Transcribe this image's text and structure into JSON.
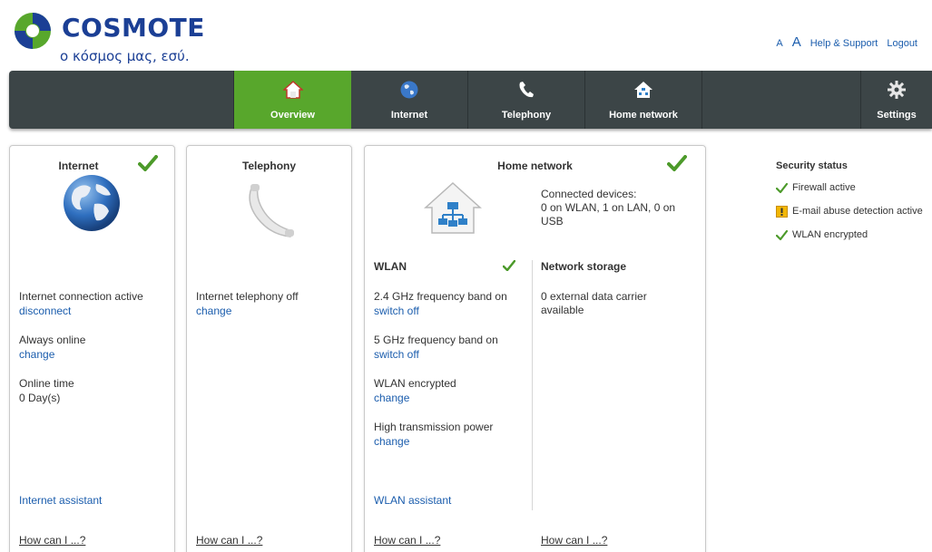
{
  "brand": {
    "name": "COSMOTE",
    "tagline": "ο κόσμος μας, εσύ."
  },
  "top_links": {
    "font_small": "A",
    "font_large": "A",
    "help": "Help & Support",
    "logout": "Logout"
  },
  "nav": {
    "tabs": [
      {
        "label": "Overview",
        "icon": "home-icon",
        "active": true
      },
      {
        "label": "Internet",
        "icon": "globe-icon",
        "active": false
      },
      {
        "label": "Telephony",
        "icon": "phone-icon",
        "active": false
      },
      {
        "label": "Home network",
        "icon": "home-network-icon",
        "active": false
      },
      {
        "label": "Settings",
        "icon": "gear-icon",
        "active": false
      }
    ]
  },
  "internet_card": {
    "title": "Internet",
    "status_line": "Internet connection active",
    "disconnect": "disconnect",
    "always_online": "Always online",
    "always_online_change": "change",
    "online_time_label": "Online time",
    "online_time_value": "0 Day(s)",
    "assistant": "Internet assistant",
    "how": "How can I ...?"
  },
  "telephony_card": {
    "title": "Telephony",
    "status_line": "Internet telephony off",
    "change": "change",
    "how": "How can I ...?"
  },
  "home_network_card": {
    "title": "Home network",
    "connected_devices": "Connected devices:\n0 on WLAN, 1 on LAN, 0 on\nUSB",
    "wlan": {
      "title": "WLAN",
      "band24": "2.4 GHz frequency band on",
      "band24_action": "switch off",
      "band5": "5 GHz frequency band on",
      "band5_action": "switch off",
      "encrypted": "WLAN encrypted",
      "encrypted_action": "change",
      "power": "High transmission power",
      "power_action": "change",
      "assistant": "WLAN assistant",
      "how": "How can I ...?"
    },
    "storage": {
      "title": "Network storage",
      "status": "0 external data carrier\navailable",
      "how": "How can I ...?"
    }
  },
  "security": {
    "title": "Security status",
    "items": [
      {
        "label": "Firewall active",
        "status": "ok"
      },
      {
        "label": "E-mail abuse detection active",
        "status": "warning"
      },
      {
        "label": "WLAN encrypted",
        "status": "ok"
      }
    ]
  },
  "colors": {
    "brand_blue": "#1b3f95",
    "link_blue": "#1b5dad",
    "nav_dark": "#3c4547",
    "active_green": "#58a72c",
    "check_green": "#4c9a2a",
    "warning_yellow": "#f2b705"
  }
}
